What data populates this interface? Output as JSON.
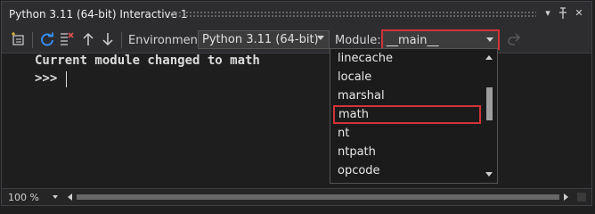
{
  "window": {
    "title": "Python 3.11 (64-bit) Interactive 1",
    "controls": {
      "dropdown": "▾",
      "pin": "⊣",
      "close": "✕"
    }
  },
  "toolbar": {
    "environment_label": "Environment:",
    "environment_value": "Python 3.11 (64-bit)",
    "module_label": "Module:",
    "module_value": "__main__"
  },
  "console": {
    "lines": [
      "Current module changed to math",
      ">>> "
    ]
  },
  "module_dropdown": {
    "items": [
      "linecache",
      "locale",
      "marshal",
      "math",
      "nt",
      "ntpath",
      "opcode"
    ],
    "selected": "math"
  },
  "statusbar": {
    "zoom": "100 %"
  },
  "colors": {
    "highlight_border": "#d13438",
    "background": "#1e1e1e",
    "toolbar": "#2d2d30",
    "accent_blue": "#3794ff"
  }
}
